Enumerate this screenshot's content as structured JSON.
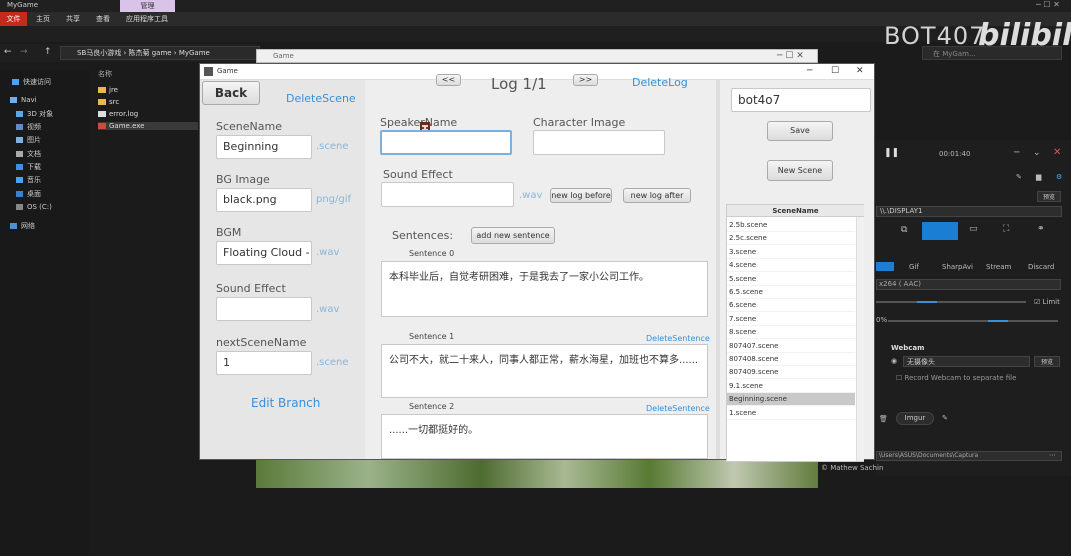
{
  "explorer": {
    "title": "MyGame",
    "manage_tab": "管理",
    "ribbon": [
      "文件",
      "主页",
      "共享",
      "查看",
      "应用程序工具"
    ],
    "path": "SB马良小游戏  ›  陈杰菊 game  ›  MyGame",
    "search_placeholder": "在 MyGam...",
    "nav": [
      "快速访问",
      "Navi",
      "3D 对象",
      "视频",
      "图片",
      "文档",
      "下载",
      "音乐",
      "桌面",
      "OS (C:)",
      "网络"
    ],
    "col_name": "名称",
    "files": [
      "jre",
      "src",
      "error.log",
      "Game.exe"
    ]
  },
  "brand": {
    "text1": "BOT407",
    "text2": "bilibili"
  },
  "back_window": {
    "title": "Game"
  },
  "game": {
    "title": "Game",
    "back": "Back",
    "delete_scene": "DeleteScene",
    "scene_name_label": "SceneName",
    "scene_name": "Beginning",
    "scene_suffix": ".scene",
    "bg_label": "BG Image",
    "bg_value": "black.png",
    "bg_suffix": "png/gif",
    "bgm_label": "BGM",
    "bgm_value": "Floating Cloud - !",
    "wav": ".wav",
    "sfx_label": "Sound Effect",
    "next_label": "nextSceneName",
    "next_value": "1",
    "edit_branch": "Edit Branch",
    "log_title": "Log 1/1",
    "delete_log": "DeleteLog",
    "speaker_label": "SpeakerName",
    "char_image_label": "Character Image",
    "log_sfx_label": "Sound Effect",
    "new_log_before": "new log before",
    "new_log_after": "new log after",
    "sentences_label": "Sentences:",
    "add_sentence": "add new sentence",
    "delete_sentence": "DeleteSentence",
    "sentences": [
      {
        "label": "Sentence 0",
        "text": "本科毕业后，自觉考研困难，于是我去了一家小公司工作。"
      },
      {
        "label": "Sentence 1",
        "text": "公司不大，就二十来人，同事人都正常，薪水海星，加班也不算多......"
      },
      {
        "label": "Sentence 2",
        "text": "......一切都挺好的。"
      }
    ],
    "project_name": "bot4o7",
    "save": "Save",
    "new_scene": "New Scene",
    "list_header": "SceneName",
    "scenes": [
      "2.5b.scene",
      "2.5c.scene",
      "3.scene",
      "4.scene",
      "5.scene",
      "6.5.scene",
      "6.scene",
      "7.scene",
      "8.scene",
      "807407.scene",
      "807408.scene",
      "807409.scene",
      "9.1.scene",
      "Beginning.scene",
      "1.scene"
    ],
    "selected_scene": "Beginning.scene"
  },
  "captura": {
    "timer": "00:01:40",
    "display": "\\\\.\\DISPLAY1",
    "preview": "预览",
    "formats": [
      "Gif",
      "SharpAvi",
      "Stream",
      "Discard"
    ],
    "codec": "x264 ( AAC)",
    "limit": "Limit",
    "pct": "0%",
    "webcam_label": "Webcam",
    "webcam_value": "无摄像头",
    "record_webcam": "Record Webcam to separate file",
    "imgur": "Imgur",
    "path": "\\Users\\ASUS\\Documents\\Captura",
    "credit": "© Mathew Sachin"
  },
  "colors": {
    "link": "#3a8fd6",
    "accent": "#0078d7"
  }
}
